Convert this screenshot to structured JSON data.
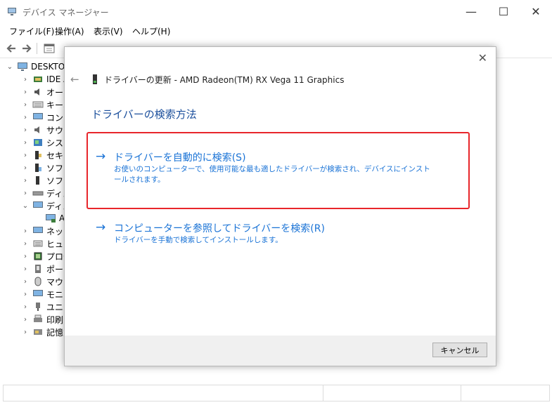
{
  "window": {
    "title": "デバイス マネージャー",
    "controls": {
      "minimize": "—",
      "maximize": "☐",
      "close": "✕"
    }
  },
  "menu": {
    "items": [
      {
        "label": "ファイル(F)"
      },
      {
        "label": "操作(A)"
      },
      {
        "label": "表示(V)"
      },
      {
        "label": "ヘルプ(H)"
      }
    ]
  },
  "tree": {
    "root": "DESKTOP",
    "items": [
      {
        "label": "IDE A",
        "icon": "ide-controller-icon",
        "expanded": false
      },
      {
        "label": "オーデ",
        "icon": "audio-icon",
        "expanded": false
      },
      {
        "label": "キーボ",
        "icon": "keyboard-icon",
        "expanded": false
      },
      {
        "label": "コンピ",
        "icon": "computer-icon",
        "expanded": false
      },
      {
        "label": "サウン",
        "icon": "sound-icon",
        "expanded": false
      },
      {
        "label": "システ",
        "icon": "system-icon",
        "expanded": false
      },
      {
        "label": "セキュ",
        "icon": "security-icon",
        "expanded": false
      },
      {
        "label": "ソフト",
        "icon": "software-component-icon",
        "expanded": false
      },
      {
        "label": "ソフト",
        "icon": "software-device-icon",
        "expanded": false
      },
      {
        "label": "ディス",
        "icon": "disk-drive-icon",
        "expanded": false
      },
      {
        "label": "ディス",
        "icon": "display-adapter-icon",
        "expanded": true
      },
      {
        "label": "A",
        "icon": "display-device-icon",
        "child": true
      },
      {
        "label": "ネット",
        "icon": "network-icon",
        "expanded": false
      },
      {
        "label": "ヒュー",
        "icon": "hid-icon",
        "expanded": false
      },
      {
        "label": "プロセ",
        "icon": "processor-icon",
        "expanded": false
      },
      {
        "label": "ポート",
        "icon": "port-icon",
        "expanded": false
      },
      {
        "label": "マウス",
        "icon": "mouse-icon",
        "expanded": false
      },
      {
        "label": "モニタ",
        "icon": "monitor-icon",
        "expanded": false
      },
      {
        "label": "ユニバ",
        "icon": "usb-icon",
        "expanded": false
      },
      {
        "label": "印刷",
        "icon": "printer-icon",
        "expanded": false
      },
      {
        "label": "記憶",
        "icon": "storage-icon",
        "expanded": false
      }
    ]
  },
  "dialog": {
    "close_glyph": "✕",
    "back_glyph": "←",
    "header": "ドライバーの更新 - AMD Radeon(TM) RX Vega 11 Graphics",
    "heading": "ドライバーの検索方法",
    "options": [
      {
        "arrow": "→",
        "title": "ドライバーを自動的に検索(S)",
        "description": "お使いのコンピューターで、使用可能な最も適したドライバーが検索され、デバイスにインストールされます。"
      },
      {
        "arrow": "→",
        "title": "コンピューターを参照してドライバーを検索(R)",
        "description": "ドライバーを手動で検索してインストールします。"
      }
    ],
    "cancel_label": "キャンセル"
  },
  "colors": {
    "link_blue": "#1a73d6",
    "heading_blue": "#1b4f9c",
    "highlight_red": "#e8262b",
    "footer_gray": "#f0f0f0"
  }
}
